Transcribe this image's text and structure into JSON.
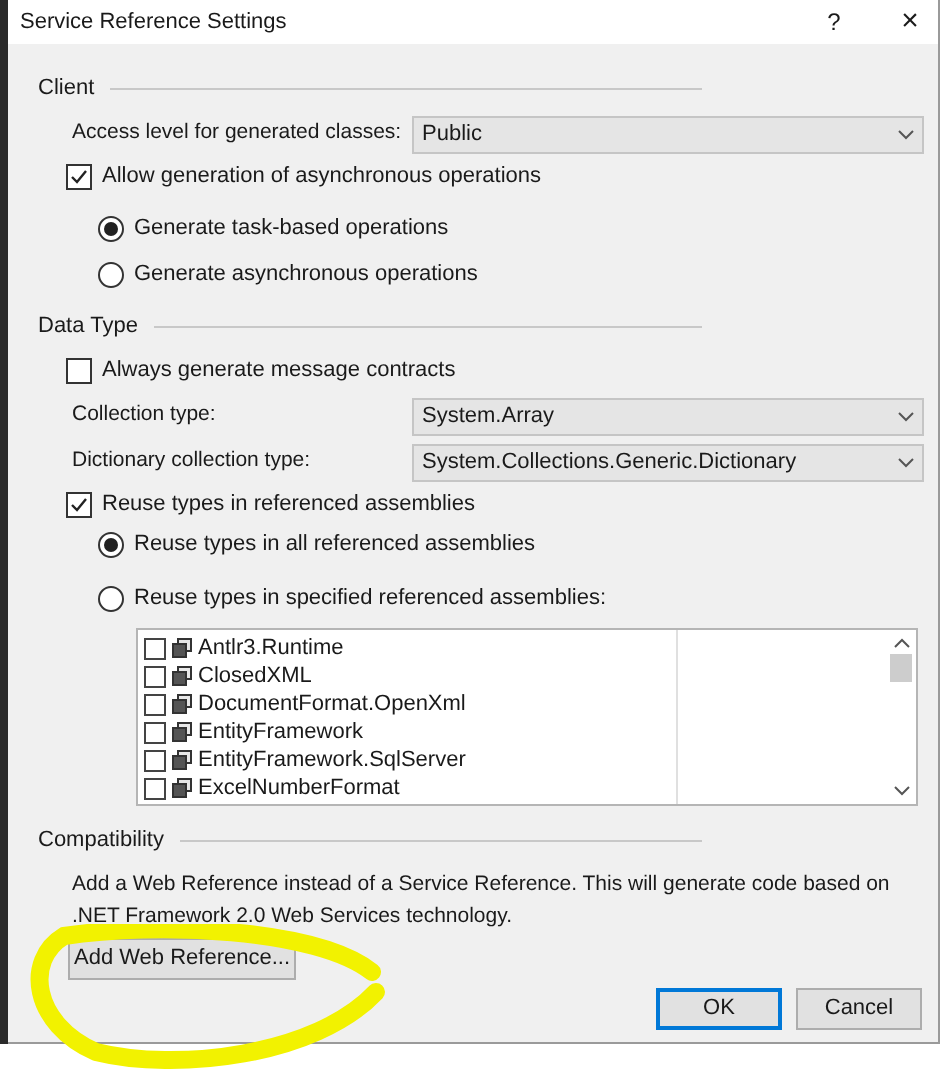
{
  "window": {
    "title": "Service Reference Settings",
    "help": "?",
    "close": "×"
  },
  "client": {
    "heading": "Client",
    "access_level": {
      "label": "Access level for generated classes:",
      "value": "Public"
    },
    "allow_async": {
      "label": "Allow generation of asynchronous operations",
      "checked": true
    },
    "operations": [
      {
        "label": "Generate task-based operations",
        "selected": true
      },
      {
        "label": "Generate asynchronous operations",
        "selected": false
      }
    ]
  },
  "data_type": {
    "heading": "Data Type",
    "always_generate": {
      "label": "Always generate message contracts",
      "checked": false
    },
    "collection_type": {
      "label": "Collection type:",
      "value": "System.Array"
    },
    "dictionary_collection_type": {
      "label": "Dictionary collection type:",
      "value": "System.Collections.Generic.Dictionary"
    },
    "reuse_types": {
      "label": "Reuse types in referenced assemblies",
      "checked": true
    },
    "reuse_options": [
      {
        "label": "Reuse types in all referenced assemblies",
        "selected": true
      },
      {
        "label": "Reuse types in specified referenced assemblies:",
        "selected": false
      }
    ],
    "assemblies": [
      {
        "name": "Antlr3.Runtime",
        "checked": false
      },
      {
        "name": "ClosedXML",
        "checked": false
      },
      {
        "name": "DocumentFormat.OpenXml",
        "checked": false
      },
      {
        "name": "EntityFramework",
        "checked": false
      },
      {
        "name": "EntityFramework.SqlServer",
        "checked": false
      },
      {
        "name": "ExcelNumberFormat",
        "checked": false
      }
    ]
  },
  "compatibility": {
    "heading": "Compatibility",
    "description": "Add a Web Reference instead of a Service Reference. This will generate code based on .NET Framework 2.0 Web Services technology.",
    "button": "Add Web Reference..."
  },
  "buttons": [
    {
      "label": "OK",
      "default": true
    },
    {
      "label": "Cancel",
      "default": false
    }
  ]
}
